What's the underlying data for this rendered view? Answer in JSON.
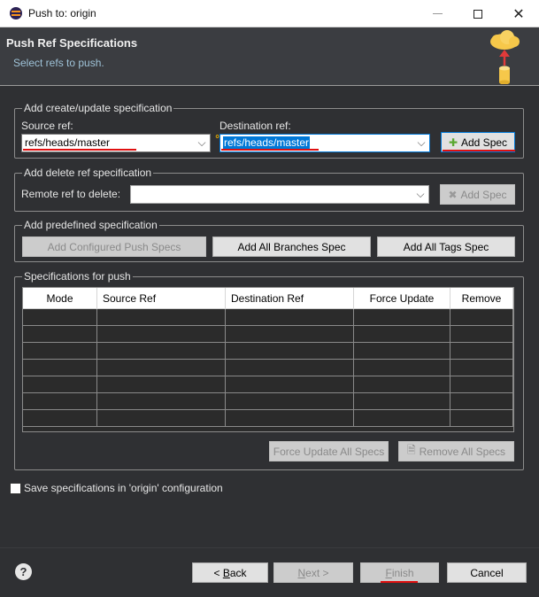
{
  "window": {
    "title": "Push to: origin",
    "minimize": "—",
    "maximize": "☐",
    "close": "✕"
  },
  "header": {
    "title": "Push Ref Specifications",
    "subtitle": "Select refs to push."
  },
  "create_update": {
    "legend": "Add create/update specification",
    "source_label": "Source ref:",
    "source_value": "refs/heads/master",
    "destination_label": "Destination ref:",
    "destination_value": "refs/heads/master",
    "add_spec": "Add Spec"
  },
  "delete_ref": {
    "legend": "Add delete ref specification",
    "remote_label": "Remote ref to delete:",
    "remote_value": "",
    "add_spec": "Add Spec"
  },
  "predefined": {
    "legend": "Add predefined specification",
    "configured": "Add Configured Push Specs",
    "all_branches": "Add All Branches Spec",
    "all_tags": "Add All Tags Spec"
  },
  "specs": {
    "legend": "Specifications for push",
    "columns": [
      "Mode",
      "Source Ref",
      "Destination Ref",
      "Force Update",
      "Remove"
    ],
    "force_all": "Force Update All Specs",
    "remove_all": "Remove All Specs"
  },
  "save_config": {
    "label": "Save specifications in 'origin' configuration",
    "checked": false
  },
  "footer": {
    "back_pre": "< ",
    "back_key": "B",
    "back_rest": "ack",
    "next_key": "N",
    "next_rest": "ext >",
    "finish_key": "F",
    "finish_rest": "inish",
    "cancel": "Cancel"
  },
  "colors": {
    "background": "#2f3033",
    "accent": "#0078d7",
    "annotation": "#e01010"
  },
  "icons": {
    "app": "eclipse-icon",
    "wizard": "cloud-push-icon",
    "add": "plus-icon",
    "remove": "remove-icon",
    "help": "help-icon"
  }
}
